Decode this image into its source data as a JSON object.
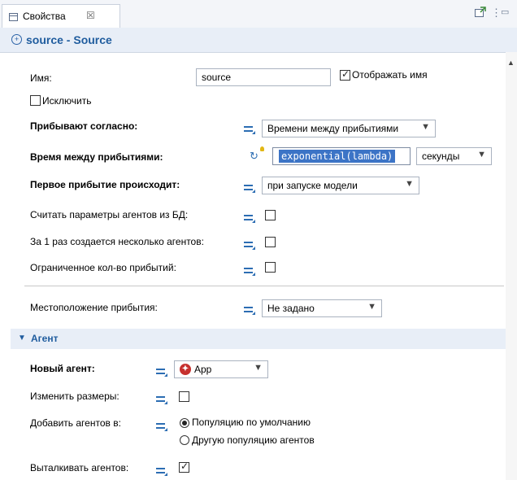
{
  "tab": {
    "title": "Свойства",
    "close": "☒"
  },
  "header": {
    "title": "source - Source",
    "icon": "add-circle-icon"
  },
  "fields": {
    "name": {
      "label": "Имя:",
      "value": "source",
      "show_name_label": "Отображать имя",
      "show_name_checked": true
    },
    "exclude": {
      "label": "Исключить",
      "checked": false
    },
    "arrivals": {
      "label": "Прибывают согласно:",
      "value": "Времени между прибытиями"
    },
    "interarrival": {
      "label": "Время между прибытиями:",
      "expression": "exponential(lambda)",
      "unit": "секунды"
    },
    "first_arrival": {
      "label": "Первое прибытие происходит:",
      "value": "при запуске модели"
    },
    "read_db": {
      "label": "Считать параметры агентов из БД:",
      "checked": false
    },
    "multiple": {
      "label": "За 1 раз создается несколько агентов:",
      "checked": false
    },
    "limited": {
      "label": "Ограниченное кол-во прибытий:",
      "checked": false
    },
    "location": {
      "label": "Местоположение прибытия:",
      "value": "Не задано"
    }
  },
  "agent_section": {
    "title": "Агент",
    "new_agent": {
      "label": "Новый агент:",
      "value": "App",
      "icon": "agent-icon"
    },
    "resize": {
      "label": "Изменить размеры:",
      "checked": false
    },
    "add_to": {
      "label": "Добавить агентов в:",
      "options": [
        "Популяцию по умолчанию",
        "Другую популяцию агентов"
      ],
      "selected": 0
    },
    "push": {
      "label": "Выталкивать агентов:",
      "checked": true
    }
  }
}
